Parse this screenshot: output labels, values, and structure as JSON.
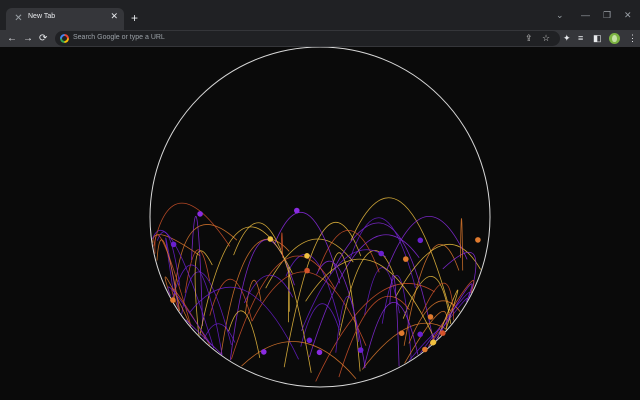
{
  "tab": {
    "title": "New Tab",
    "close": "✕",
    "favicon": "chrome-tab-favicon-icon"
  },
  "tabstrip": {
    "new_tab": "+",
    "dropdown": "⌄",
    "minimize": "—",
    "restore": "❐",
    "close": "✕"
  },
  "toolbar": {
    "back": "←",
    "forward": "→",
    "reload": "⟳",
    "search_placeholder": "Search Google or type a URL",
    "share": "⇪",
    "star": "☆",
    "extensions": "✦",
    "reading_list": "≡",
    "side_panel": "◧",
    "menu": "⋮"
  },
  "colors": {
    "orange": "#e07a2e",
    "gold": "#f0c040",
    "red_orange": "#d4532a",
    "purple": "#8a2be2",
    "violet": "#6a1fd0",
    "circle": "#d8d8d8"
  }
}
